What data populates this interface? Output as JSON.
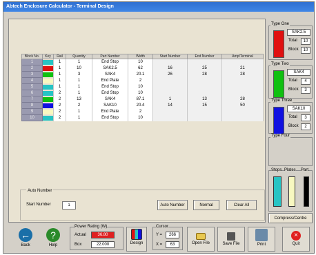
{
  "window": {
    "title": "Abtech Enclosure Calculator - Terminal Design"
  },
  "table": {
    "headers": [
      "Block No.",
      "Key",
      "Rail",
      "Quantity",
      "Part Number",
      "Width",
      "Start Number",
      "End Number",
      "Amp/Terminal"
    ],
    "rows": [
      {
        "block": "1",
        "key": "#27c4c4",
        "rail": "1",
        "qty": "1",
        "part": "End Stop",
        "width": "10",
        "start": "",
        "end": "",
        "amp": ""
      },
      {
        "block": "2",
        "key": "#e01010",
        "rail": "1",
        "qty": "10",
        "part": "SAK2.5",
        "width": "62",
        "start": "16",
        "end": "25",
        "amp": "21"
      },
      {
        "block": "3",
        "key": "#10c010",
        "rail": "1",
        "qty": "3",
        "part": "SAK4",
        "width": "20.1",
        "start": "26",
        "end": "28",
        "amp": "28"
      },
      {
        "block": "4",
        "key": "#f8f8c0",
        "rail": "1",
        "qty": "1",
        "part": "End Plate",
        "width": "2",
        "start": "",
        "end": "",
        "amp": ""
      },
      {
        "block": "5",
        "key": "#27c4c4",
        "rail": "1",
        "qty": "1",
        "part": "End Stop",
        "width": "10",
        "start": "",
        "end": "",
        "amp": ""
      },
      {
        "block": "6",
        "key": "#27c4c4",
        "rail": "2",
        "qty": "1",
        "part": "End Stop",
        "width": "10",
        "start": "",
        "end": "",
        "amp": ""
      },
      {
        "block": "7",
        "key": "#10c010",
        "rail": "2",
        "qty": "13",
        "part": "SAK4",
        "width": "87.1",
        "start": "1",
        "end": "13",
        "amp": "28"
      },
      {
        "block": "8",
        "key": "#1010e0",
        "rail": "2",
        "qty": "2",
        "part": "SAK10",
        "width": "20.4",
        "start": "14",
        "end": "15",
        "amp": "50"
      },
      {
        "block": "9",
        "key": "#f8f8c0",
        "rail": "2",
        "qty": "1",
        "part": "End Plate",
        "width": "2",
        "start": "",
        "end": "",
        "amp": ""
      },
      {
        "block": "10",
        "key": "#27c4c4",
        "rail": "2",
        "qty": "1",
        "part": "End Stop",
        "width": "10",
        "start": "",
        "end": "",
        "amp": ""
      }
    ]
  },
  "auto_number": {
    "label": "Auto Number",
    "start_label": "Start Number",
    "start_value": "1",
    "btn_auto": "Auto Number",
    "btn_normal": "Normal",
    "btn_clear": "Clear All"
  },
  "types": [
    {
      "label": "Type One",
      "color": "#e01010",
      "part": "SAK2.5",
      "total_label": "Total",
      "total": "10",
      "block_label": "Block",
      "block": "10"
    },
    {
      "label": "Type Two",
      "color": "#10c010",
      "part": "SAK4",
      "total_label": "Total",
      "total": "4",
      "block_label": "Block",
      "block": "3"
    },
    {
      "label": "Type Three",
      "color": "#1010e0",
      "part": "SAK10",
      "total_label": "Total",
      "total": "3",
      "block_label": "Block",
      "block": "2"
    },
    {
      "label": "Type Four"
    }
  ],
  "legend": {
    "stops": "Stops",
    "plates": "Plates",
    "part": "Part",
    "compress": "Compress/Centre"
  },
  "bottom": {
    "back": "Back",
    "help": "Help",
    "power_label": "Power Rating (W)",
    "actual_label": "Actual",
    "actual_value": "36.80",
    "box_label": "Box",
    "box_value": "22.000",
    "design": "Design",
    "cursor_label": "Cursor",
    "y_label": "Y =",
    "y_value": "266",
    "x_label": "X =",
    "x_value": "63",
    "open": "Open File",
    "save": "Save File",
    "print": "Print",
    "quit": "Quit"
  }
}
